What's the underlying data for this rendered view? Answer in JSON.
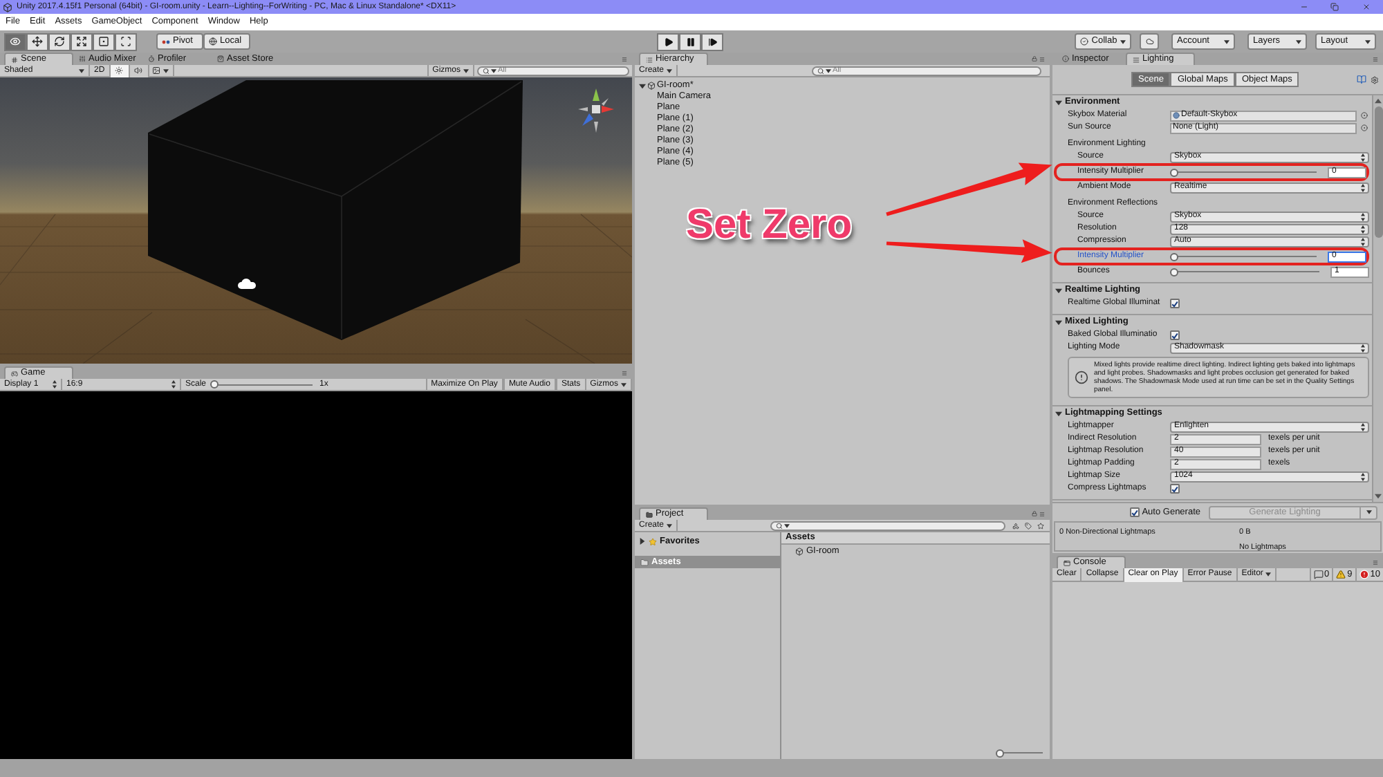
{
  "window": {
    "title": "Unity 2017.4.15f1 Personal (64bit) - GI-room.unity - Learn--Lighting--ForWriting - PC, Mac & Linux Standalone* <DX11>"
  },
  "menu": [
    "File",
    "Edit",
    "Assets",
    "GameObject",
    "Component",
    "Window",
    "Help"
  ],
  "toolbar": {
    "tools": [
      {
        "selected": true
      },
      {
        "selected": false
      },
      {
        "selected": false
      },
      {
        "selected": false
      },
      {
        "selected": false
      },
      {
        "selected": false
      }
    ],
    "pivot": "Pivot",
    "local": "Local",
    "collab": "Collab",
    "account": "Account",
    "layers": "Layers",
    "layout": "Layout"
  },
  "scene_panel": {
    "tabs": [
      {
        "label": "Scene",
        "selected": true
      },
      {
        "label": "Audio Mixer",
        "selected": false
      },
      {
        "label": "Profiler",
        "selected": false
      },
      {
        "label": "Asset Store",
        "selected": false
      }
    ],
    "shading": "Shaded",
    "mode_2d": "2D",
    "lighting_toggle": {
      "on": true
    },
    "audio_toggle": {
      "on": false
    },
    "gizmos": "Gizmos",
    "search": {
      "placeholder": "All"
    }
  },
  "game_panel": {
    "tab": "Game",
    "display": "Display 1",
    "aspect": "16:9",
    "scale": {
      "label": "Scale",
      "level": 0,
      "reading": "1x"
    },
    "buttons": [
      "Maximize On Play",
      "Mute Audio",
      "Stats"
    ],
    "gizmos": "Gizmos"
  },
  "hierarchy": {
    "tab": "Hierarchy",
    "create": "Create",
    "search": {
      "placeholder": "All"
    },
    "scene": {
      "label": "GI-room*",
      "expanded": true,
      "children": [
        {
          "label": "Main Camera"
        },
        {
          "label": "Plane"
        },
        {
          "label": "Plane (1)"
        },
        {
          "label": "Plane (2)"
        },
        {
          "label": "Plane (3)"
        },
        {
          "label": "Plane (4)"
        },
        {
          "label": "Plane (5)"
        }
      ]
    }
  },
  "project": {
    "tab": "Project",
    "create": "Create",
    "tree": [
      {
        "label": "Favorites",
        "kind": "favorites",
        "selected": false
      },
      {
        "label": "Assets",
        "kind": "folder",
        "selected": true
      }
    ],
    "breadcrumb": "Assets",
    "items": [
      {
        "label": "GI-room"
      }
    ],
    "size_slider": {
      "level": 0
    }
  },
  "inspector": {
    "tabs": [
      {
        "label": "Inspector",
        "selected": false
      },
      {
        "label": "Lighting",
        "selected": true
      }
    ],
    "segments": [
      {
        "label": "Scene",
        "selected": true
      },
      {
        "label": "Global Maps",
        "selected": false
      },
      {
        "label": "Object Maps",
        "selected": false
      }
    ],
    "sections": [
      {
        "title": "Environment",
        "expanded": true,
        "rows": [
          {
            "kind": "asset",
            "label": "Skybox Material",
            "value": "Default-Skybox"
          },
          {
            "kind": "object",
            "label": "Sun Source",
            "value": "None (Light)"
          },
          {
            "kind": "group",
            "label": "Environment Lighting",
            "children": [
              {
                "kind": "dropdown",
                "label": "Source",
                "value": "Skybox"
              },
              {
                "kind": "slider",
                "label": "Intensity Multiplier",
                "level": 0,
                "value": "0",
                "focused": false,
                "highlighted": true
              },
              {
                "kind": "dropdown",
                "label": "Ambient Mode",
                "value": "Realtime"
              }
            ]
          },
          {
            "kind": "group",
            "label": "Environment Reflections",
            "children": [
              {
                "kind": "dropdown",
                "label": "Source",
                "value": "Skybox"
              },
              {
                "kind": "dropdown",
                "label": "Resolution",
                "value": "128"
              },
              {
                "kind": "dropdown",
                "label": "Compression",
                "value": "Auto"
              },
              {
                "kind": "slider",
                "label": "Intensity Multiplier",
                "level": 0,
                "value": "0",
                "focused": true,
                "highlighted": true
              },
              {
                "kind": "slider",
                "label": "Bounces",
                "level": 0,
                "value": "1",
                "focused": false,
                "highlighted": false
              }
            ]
          }
        ]
      },
      {
        "title": "Realtime Lighting",
        "expanded": true,
        "rows": [
          {
            "kind": "checkbox",
            "label": "Realtime Global Illuminat",
            "checked": true
          }
        ]
      },
      {
        "title": "Mixed Lighting",
        "expanded": true,
        "rows": [
          {
            "kind": "checkbox",
            "label": "Baked Global Illuminatio",
            "checked": true
          },
          {
            "kind": "dropdown",
            "label": "Lighting Mode",
            "value": "Shadowmask"
          },
          {
            "kind": "info",
            "text": "Mixed lights provide realtime direct lighting. Indirect lighting gets baked into lightmaps and light probes. Shadowmasks and light probes occlusion get generated for baked shadows. The Shadowmask Mode used at run time can be set in the Quality Settings panel."
          }
        ]
      },
      {
        "title": "Lightmapping Settings",
        "expanded": true,
        "rows": [
          {
            "kind": "dropdown",
            "label": "Lightmapper",
            "value": "Enlighten"
          },
          {
            "kind": "number",
            "label": "Indirect Resolution",
            "value": "2",
            "unit": "texels per unit"
          },
          {
            "kind": "number",
            "label": "Lightmap Resolution",
            "value": "40",
            "unit": "texels per unit"
          },
          {
            "kind": "number",
            "label": "Lightmap Padding",
            "value": "2",
            "unit": "texels"
          },
          {
            "kind": "dropdown",
            "label": "Lightmap Size",
            "value": "1024"
          },
          {
            "kind": "checkbox",
            "label": "Compress Lightmaps",
            "checked": true
          }
        ]
      }
    ],
    "auto_generate": {
      "label": "Auto Generate",
      "checked": true
    },
    "generate_button": {
      "label": "Generate Lighting",
      "disabled": true
    },
    "stats": {
      "label": "0 Non-Directional Lightmaps",
      "size": "0 B",
      "note": "No Lightmaps"
    }
  },
  "console": {
    "tab": "Console",
    "buttons": [
      {
        "label": "Clear",
        "selected": false
      },
      {
        "label": "Collapse",
        "selected": false
      },
      {
        "label": "Clear on Play",
        "selected": true
      },
      {
        "label": "Error Pause",
        "selected": false
      }
    ],
    "editor": "Editor",
    "counts": [
      {
        "kind": "info",
        "count": "0"
      },
      {
        "kind": "warning",
        "count": "9"
      },
      {
        "kind": "error",
        "count": "10"
      }
    ]
  },
  "annotation": {
    "callout": "Set Zero"
  }
}
